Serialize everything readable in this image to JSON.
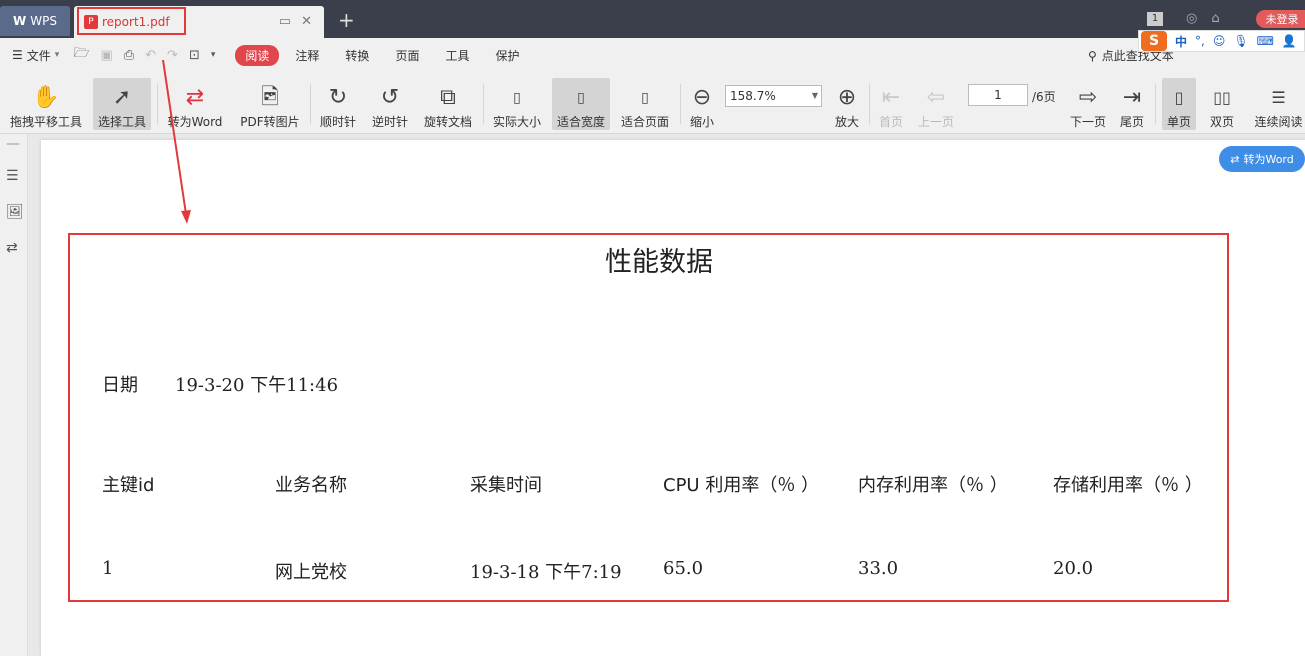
{
  "tabs": {
    "app_label": "WPS",
    "doc_name": "report1.pdf",
    "new_tab": "+",
    "badge": "1",
    "login": "未登录"
  },
  "menubar": {
    "file": "文件",
    "read": "阅读",
    "items": [
      "注释",
      "转换",
      "页面",
      "工具",
      "保护"
    ],
    "search": "点此查找文本"
  },
  "ime": {
    "s": "S",
    "zh": "中",
    "punct": "°,"
  },
  "toolbar": {
    "hand": "拖拽平移工具",
    "select": "选择工具",
    "to_word": "转为Word",
    "pdf_to_img": "PDF转图片",
    "cw": "顺时针",
    "ccw": "逆时针",
    "rotate_doc": "旋转文档",
    "actual": "实际大小",
    "fit_width": "适合宽度",
    "fit_page": "适合页面",
    "zoom_out": "缩小",
    "zoom": "158.7%",
    "zoom_in": "放大",
    "first": "首页",
    "prev": "上一页",
    "page": "1",
    "total": "/6页",
    "next": "下一页",
    "last": "尾页",
    "single": "单页",
    "double": "双页",
    "continuous": "连续阅读"
  },
  "float_word": "转为Word",
  "document": {
    "title": "性能数据",
    "date_label": "日期",
    "date_value": "19-3-20 下午11:46",
    "headers": [
      "主键id",
      "业务名称",
      "采集时间",
      "CPU 利用率（％ ）",
      "内存利用率（％ ）",
      "存储利用率（％ ）"
    ],
    "row": [
      "1",
      "网上党校",
      "19-3-18 下午7:19",
      "65.0",
      "33.0",
      "20.0"
    ]
  },
  "colors": {
    "accent_red": "#e23a3a",
    "word_blue": "#3e8ee8"
  }
}
